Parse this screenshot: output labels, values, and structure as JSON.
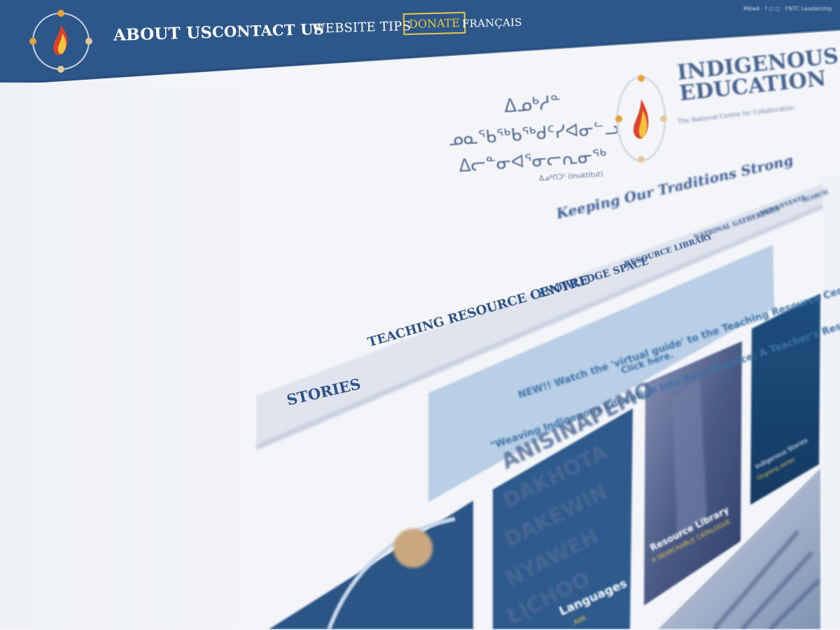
{
  "nav": {
    "links": [
      "ABOUT US",
      "CONTACT US",
      "WEBSITE TIPS"
    ],
    "donate": "DONATE",
    "francais": "FRANÇAIS",
    "mini_links": "Mēwē · f ◻ ◻ · FNTC Leadership"
  },
  "brand": {
    "syllabics_line1": "ᐃᓄᒃᓱᓐ",
    "syllabics_line2": "ᓄᓇᖃᖅᑲᖅᑯᑦᓯᐊᓂᓪᓗ",
    "syllabics_line3": "ᐃᓕᓐᓂᐊᕐᓂᓕᕆᓂᖅ",
    "syllabics_note": "ᐃᓄᒃᑎᑐᑦ (Inuktitut)",
    "title_line1": "INDIGENOUS",
    "title_line2": "EDUCATION",
    "subtitle": "The National Centre for Collaboration",
    "tagline": "Keeping Our Traditions Strong"
  },
  "menu": {
    "items": [
      "STORIES",
      "TEACHING RESOURCE CENTRE",
      "KNOWLEDGE SPACE",
      "RESOURCE LIBRARY",
      "NATIONAL GATHERINGS",
      "NEWS/EVENTS",
      "SEARCH"
    ]
  },
  "notice": {
    "line1": "NEW!! Watch the 'virtual guide' to the Teaching Resource Centre:",
    "line2": "\"Weaving Indigenous Education into Your Practice: A Teacher's Resource Guide\"",
    "line3": "Click here."
  },
  "tiles": {
    "languages_words": [
      "ANISINAPEMO",
      "DAKHOTA",
      "DAKEWIN",
      "NYAWEH",
      "ŁĮCHOO"
    ],
    "languages_title": "Languages",
    "languages_sub": "AIM",
    "library_title": "Resource Library",
    "library_sub": "A SEARCHABLE CATALOGUE",
    "far_title": "Indigenous Stories",
    "far_sub": "Ongoing series"
  },
  "colors": {
    "nav_bg": "#2d5789",
    "brand_blue": "#2d5287",
    "donate_gold": "#e8c84a",
    "notice_bg": "#b8cfe6",
    "menu_bg": "#dfe4ee",
    "tile_dark": "#2b5585"
  }
}
